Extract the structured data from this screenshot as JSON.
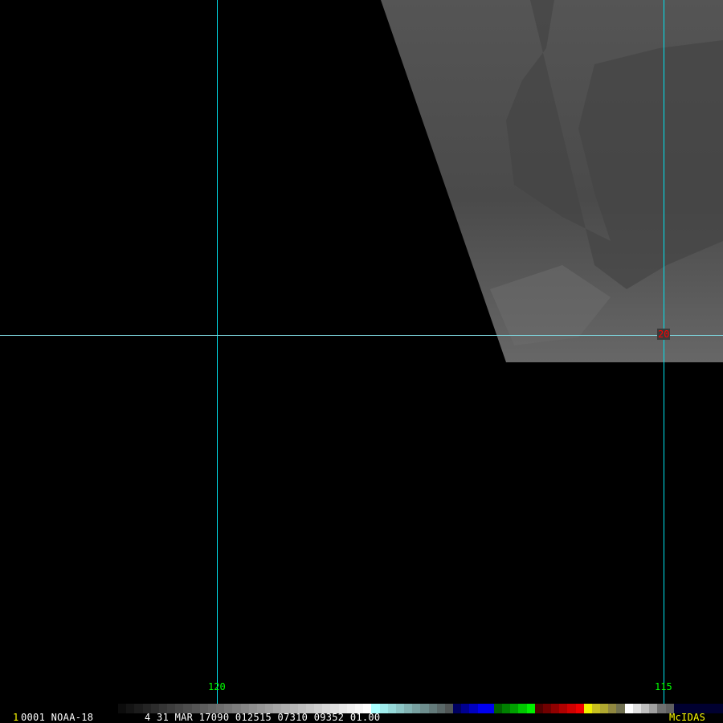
{
  "image": {
    "satellite": "NOAA-18",
    "frame_number": "1",
    "header": "0001 NOAA-18",
    "info": "4 31 MAR 17090 012515 07310 09352 01.00",
    "software": "McIDAS"
  },
  "grid": {
    "longitude_labels": [
      "120",
      "115"
    ],
    "latitude_labels": [
      "20"
    ]
  },
  "colors": {
    "grid_line": "#00e5f0",
    "lon_label": "#00ff00",
    "lat_label": "#ff0000",
    "logo": "#ffff00",
    "frame_number": "#ffff00"
  }
}
